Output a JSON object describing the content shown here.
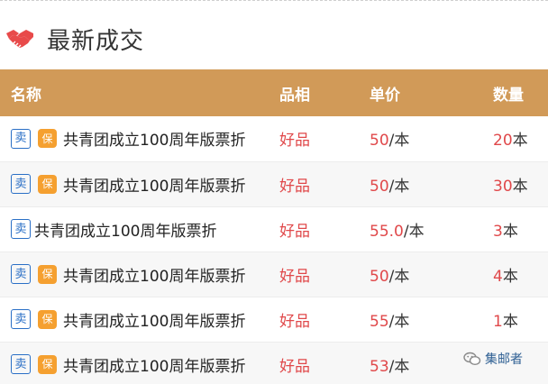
{
  "header": {
    "title": "最新成交",
    "icon": "handshake-icon"
  },
  "table": {
    "columns": [
      "名称",
      "品相",
      "单价",
      "数量"
    ],
    "rows": [
      {
        "sell": "卖",
        "guarantee": "保",
        "name": "共青团成立100周年版票折",
        "quality": "好品",
        "price_value": "50",
        "price_unit": "/本",
        "qty_value": "20",
        "qty_unit": "本"
      },
      {
        "sell": "卖",
        "guarantee": "保",
        "name": "共青团成立100周年版票折",
        "quality": "好品",
        "price_value": "50",
        "price_unit": "/本",
        "qty_value": "30",
        "qty_unit": "本"
      },
      {
        "sell": "卖",
        "guarantee": "",
        "name": "共青团成立100周年版票折",
        "quality": "好品",
        "price_value": "55.0",
        "price_unit": "/本",
        "qty_value": "3",
        "qty_unit": "本"
      },
      {
        "sell": "卖",
        "guarantee": "保",
        "name": "共青团成立100周年版票折",
        "quality": "好品",
        "price_value": "50",
        "price_unit": "/本",
        "qty_value": "4",
        "qty_unit": "本"
      },
      {
        "sell": "卖",
        "guarantee": "保",
        "name": "共青团成立100周年版票折",
        "quality": "好品",
        "price_value": "55",
        "price_unit": "/本",
        "qty_value": "1",
        "qty_unit": "本"
      },
      {
        "sell": "卖",
        "guarantee": "保",
        "name": "共青团成立100周年版票折",
        "quality": "好品",
        "price_value": "53",
        "price_unit": "/本",
        "qty_value": "",
        "qty_unit": ""
      }
    ]
  },
  "watermark": {
    "text": "集邮者",
    "icon": "wechat-icon"
  },
  "colors": {
    "header_bg": "#d19a58",
    "accent_red": "#e0484a",
    "sell_blue": "#2a6fc6",
    "guarantee_orange": "#f5a030"
  }
}
